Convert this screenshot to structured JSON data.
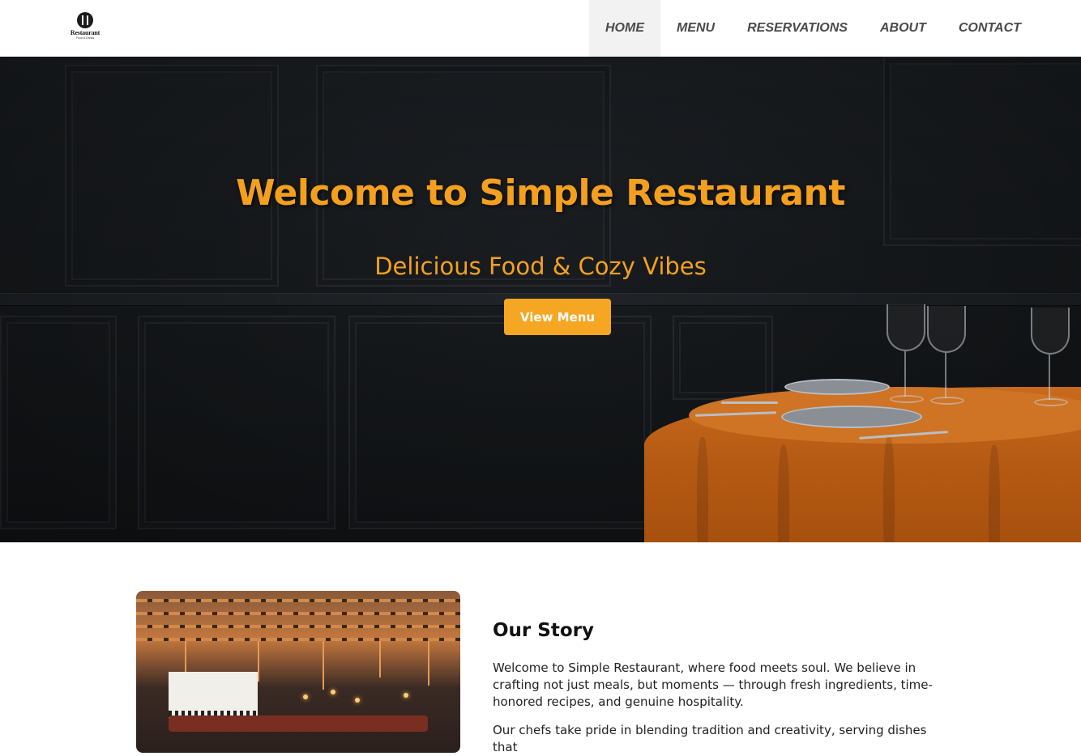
{
  "brand": {
    "logo_text": "Restaurant",
    "logo_subtext": "Food & Drinks"
  },
  "nav": {
    "items": [
      {
        "label": "HOME",
        "active": true
      },
      {
        "label": "MENU",
        "active": false
      },
      {
        "label": "RESERVATIONS",
        "active": false
      },
      {
        "label": "ABOUT",
        "active": false
      },
      {
        "label": "CONTACT",
        "active": false
      }
    ]
  },
  "hero": {
    "title": "Welcome to Simple Restaurant",
    "subtitle": "Delicious Food & Cozy Vibes",
    "button_label": "View Menu"
  },
  "story": {
    "title": "Our Story",
    "paragraphs": [
      "Welcome to Simple Restaurant, where food meets soul. We believe in crafting not just meals, but moments — through fresh ingredients, time-honored recipes, and genuine hospitality.",
      "Our chefs take pride in blending tradition and creativity, serving dishes that"
    ]
  },
  "colors": {
    "accent": "#f5a623",
    "nav_text": "#4a4a4a",
    "hero_bg": "#1e2226",
    "cloth": "#c76a1e"
  }
}
